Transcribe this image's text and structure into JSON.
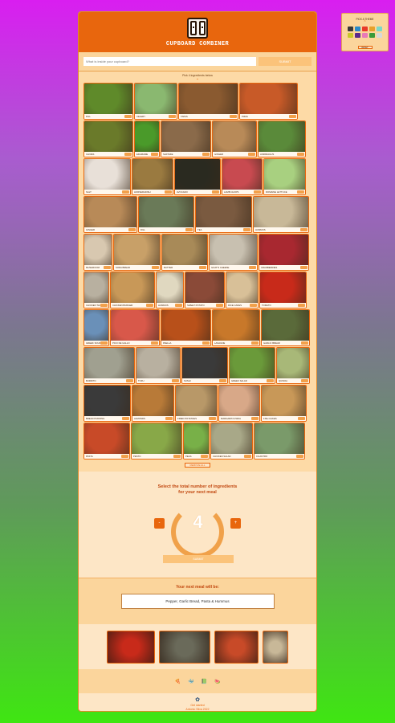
{
  "app": {
    "title": "CUPBOARD COMBINER"
  },
  "search": {
    "placeholder": "What is inside your cupboard?",
    "button": "SUBMIT"
  },
  "hint": {
    "text": "Pick 4 ingredients below",
    "arrow": "⌄"
  },
  "rows": [
    [
      {
        "label": "DILL",
        "w": 62,
        "c": "#5f8a2a"
      },
      {
        "label": "CELERY",
        "w": 54,
        "c": "#8ab870"
      },
      {
        "label": "TAPAS",
        "w": 75,
        "c": "#8a5a30"
      },
      {
        "label": "PIZZA",
        "w": 73,
        "c": "#c85a28"
      }
    ],
    [
      {
        "label": "CHIVES",
        "w": 62,
        "c": "#6a7a2a"
      },
      {
        "label": "EDAMAME",
        "w": 32,
        "c": "#4a9a2a"
      },
      {
        "label": "SHIITAKE",
        "w": 63,
        "c": "#8a6a4a"
      },
      {
        "label": "GINGER",
        "w": 56,
        "c": "#b88a58"
      },
      {
        "label": "ASPARAGUS",
        "w": 60,
        "c": "#5a8a3a"
      }
    ],
    [
      {
        "label": "SALT",
        "w": 59,
        "c": "#e8e0d8"
      },
      {
        "label": "HORSERADISH",
        "w": 52,
        "c": "#9a7a40"
      },
      {
        "label": "AVOCADO",
        "w": 58,
        "c": "#2a2a20"
      },
      {
        "label": "LAMB CHOPS",
        "w": 51,
        "c": "#c84a50"
      },
      {
        "label": "ROMAINE LETTUCE",
        "w": 53,
        "c": "#a8d080"
      }
    ],
    [
      {
        "label": "GINGER",
        "w": 67,
        "c": "#b88a58"
      },
      {
        "label": "DILL",
        "w": 70,
        "c": "#6a7a58"
      },
      {
        "label": "TEA",
        "w": 71,
        "c": "#7a5a40"
      },
      {
        "label": "HUMMUS",
        "w": 70,
        "c": "#c8b898"
      }
    ],
    [
      {
        "label": "MUSHROOM",
        "w": 36,
        "c": "#d8c8b0"
      },
      {
        "label": "SODA BREAD",
        "w": 59,
        "c": "#c8a068"
      },
      {
        "label": "BUTTER",
        "w": 58,
        "c": "#a88a58"
      },
      {
        "label": "GOAT'S CHEESE",
        "w": 61,
        "c": "#c8c0b0"
      },
      {
        "label": "CRANBERRIES",
        "w": 63,
        "c": "#a82830"
      }
    ],
    [
      {
        "label": "CHICKEN THIGHS",
        "w": 32,
        "c": "#b8b0a0"
      },
      {
        "label": "CHICKEN BURGER",
        "w": 56,
        "c": "#c89858"
      },
      {
        "label": "HUMMUS",
        "w": 35,
        "c": "#e0d8c0"
      },
      {
        "label": "SWEET POTATO",
        "w": 50,
        "c": "#8a4a38"
      },
      {
        "label": "RICE CAKES",
        "w": 41,
        "c": "#d8c098"
      },
      {
        "label": "TOMATO",
        "w": 59,
        "c": "#c82a1a"
      }
    ],
    [
      {
        "label": "GREEK SOUP",
        "w": 32,
        "c": "#6a90b8"
      },
      {
        "label": "PICO DE GALLO",
        "w": 62,
        "c": "#d8584a"
      },
      {
        "label": "PAELLA",
        "w": 63,
        "c": "#b8501a"
      },
      {
        "label": "LASAGNE",
        "w": 60,
        "c": "#c8782a"
      },
      {
        "label": "GARLIC BREAD",
        "w": 61,
        "c": "#5a6a3a"
      }
    ],
    [
      {
        "label": "BURRITO",
        "w": 64,
        "c": "#a0a090"
      },
      {
        "label": "TOFU",
        "w": 56,
        "c": "#b8b0a0"
      },
      {
        "label": "SUSHI",
        "w": 58,
        "c": "#3a3a3a"
      },
      {
        "label": "GREEK SALAD",
        "w": 58,
        "c": "#6a9a3a"
      },
      {
        "label": "QUINOA",
        "w": 42,
        "c": "#a8b878"
      }
    ],
    [
      {
        "label": "BREAD PUDDING",
        "w": 59,
        "c": "#3a3a3a"
      },
      {
        "label": "ALMONDS",
        "w": 53,
        "c": "#b87a38"
      },
      {
        "label": "FRIED POTATOES",
        "w": 53,
        "c": "#b89868"
      },
      {
        "label": "MARGARITA PIZZA",
        "w": 52,
        "c": "#d8a888"
      },
      {
        "label": "FISH CAKES",
        "w": 57,
        "c": "#c89858"
      }
    ],
    [
      {
        "label": "PASTA",
        "w": 58,
        "c": "#c84a28"
      },
      {
        "label": "PESTO",
        "w": 64,
        "c": "#88a848"
      },
      {
        "label": "PEAS",
        "w": 33,
        "c": "#78b048"
      },
      {
        "label": "CHICKEN SALAD",
        "w": 53,
        "c": "#a8a888"
      },
      {
        "label": "CILANTRO",
        "w": 64,
        "c": "#7a9a6a"
      }
    ]
  ],
  "remove": "REMOVE ALL",
  "counter": {
    "prompt1": "Select the total number of ingredients",
    "prompt2": "for your next meal",
    "value": "4",
    "minus": "-",
    "plus": "+",
    "submit": "SUBMIT"
  },
  "result": {
    "heading": "Your next meal will be:",
    "meal": "Pepper, Garlic Bread, Pasta & Hummus"
  },
  "thumbs": [
    {
      "w": 60,
      "c": "#c82a1a"
    },
    {
      "w": 64,
      "c": "#6a6a5a"
    },
    {
      "w": 55,
      "c": "#c84a28"
    },
    {
      "w": 32,
      "c": "#c8b898"
    }
  ],
  "icons": [
    "🍕",
    "🐳",
    "📗",
    "🍉"
  ],
  "footer": {
    "line1": "Get started",
    "line2": "Antonio Silva 2022"
  },
  "theme": {
    "title": "PICK A THEME",
    "button": "RESET",
    "swatches": [
      "#3a3a3a",
      "#2a8ac8",
      "#e83a2a",
      "#e8a02a",
      "#7ad8c8",
      "#c8c82a",
      "#5a2a8a",
      "#e87ab8",
      "#3a9a3a",
      "#d8d8d8"
    ]
  }
}
